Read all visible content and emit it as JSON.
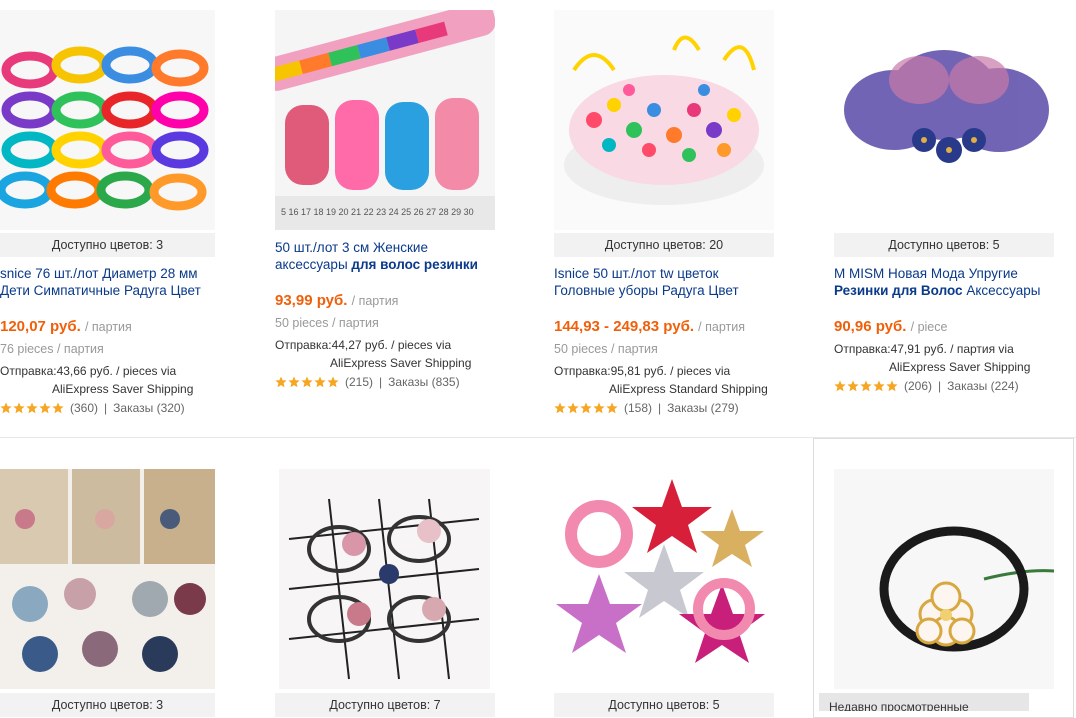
{
  "products": [
    {
      "colors": "Доступно цветов: 3",
      "title_l1": "snice 76 шт./лот Диаметр 28 мм",
      "title_l2_pre": "Дети Симпатичные Радуга Цвет",
      "title_l2_bold": "",
      "price": "120,07 руб.",
      "price_unit": "/ партия",
      "pieces": "76 pieces / партия",
      "ship_l1": "Отправка:43,66 руб. / pieces via",
      "ship_l2": "AliExpress Saver Shipping",
      "reviews": "(360)",
      "orders": "Заказы (320)"
    },
    {
      "colors": "",
      "title_l1": "50 шт./лот 3 см Женские",
      "title_l2_pre": "аксессуары ",
      "title_l2_bold": "для волос резинки",
      "price": "93,99 руб.",
      "price_unit": "/ партия",
      "pieces": "50 pieces / партия",
      "ship_l1": "Отправка:44,27 руб. / pieces via",
      "ship_l2": "AliExpress Saver Shipping",
      "reviews": "(215)",
      "orders": "Заказы (835)"
    },
    {
      "colors": "Доступно цветов: 20",
      "title_l1": "Isnice 50 шт./лот tw цветок",
      "title_l2_pre": "Головные уборы Радуга Цвет",
      "title_l2_bold": "",
      "price": "144,93 - 249,83 руб.",
      "price_unit": "/ партия",
      "pieces": "50 pieces / партия",
      "ship_l1": "Отправка:95,81 руб. / pieces via",
      "ship_l2": "AliExpress Standard Shipping",
      "reviews": "(158)",
      "orders": "Заказы (279)"
    },
    {
      "colors": "Доступно цветов: 5",
      "title_l1": "M MISM Новая Мода Упругие",
      "title_l2_pre": "",
      "title_l2_bold": "Резинки для Волос",
      "title_l2_post": " Аксессуары",
      "price": "90,96 руб.",
      "price_unit": "/ piece",
      "pieces": "",
      "ship_l1": "Отправка:47,91 руб. / партия via",
      "ship_l2": "AliExpress Saver Shipping",
      "reviews": "(206)",
      "orders": "Заказы (224)"
    }
  ],
  "row2_colors": [
    "Доступно цветов: 3",
    "Доступно цветов: 7",
    "Доступно цветов: 5"
  ],
  "separator": "|",
  "star_color": "#f5a623",
  "accent_price": "#f0600a",
  "tooltip_text": "Недавно просмотренные"
}
